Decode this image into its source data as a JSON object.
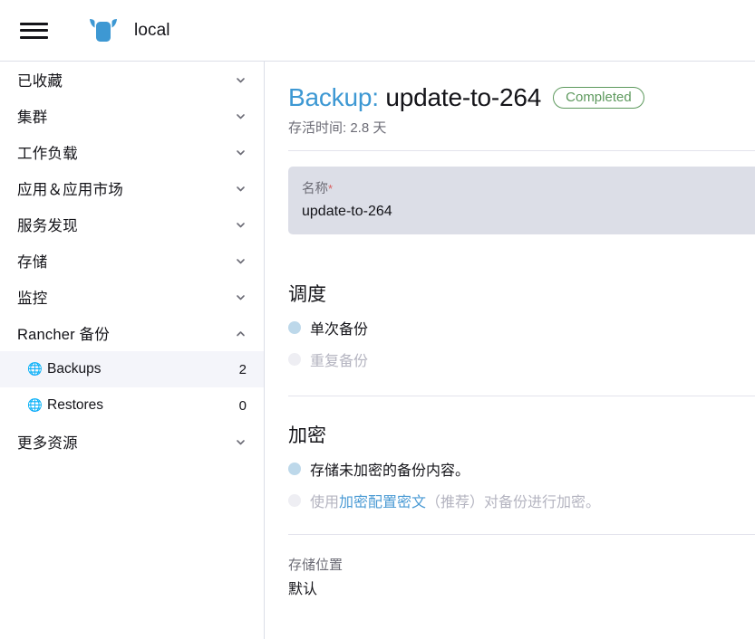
{
  "header": {
    "menu_icon": "hamburger-icon",
    "logo_icon": "rancher-cow-logo",
    "cluster_name": "local"
  },
  "sidebar": {
    "groups": [
      {
        "label": "已收藏",
        "expanded": false
      },
      {
        "label": "集群",
        "expanded": false
      },
      {
        "label": "工作负载",
        "expanded": false
      },
      {
        "label": "应用＆应用市场",
        "expanded": false
      },
      {
        "label": "服务发现",
        "expanded": false
      },
      {
        "label": "存储",
        "expanded": false
      },
      {
        "label": "监控",
        "expanded": false
      },
      {
        "label": "Rancher 备份",
        "expanded": true
      }
    ],
    "children": [
      {
        "label": "Backups",
        "count": "2",
        "icon": "globe-icon",
        "active": true
      },
      {
        "label": "Restores",
        "count": "0",
        "icon": "globe-icon",
        "active": false
      }
    ],
    "more_resources": {
      "label": "更多资源",
      "expanded": false
    }
  },
  "main": {
    "title_kind": "Backup:",
    "title_name": "update-to-264",
    "status_badge": "Completed",
    "status_color": "#5d995d",
    "subtitle": "存活时间: 2.8 天",
    "name_field": {
      "label": "名称",
      "required_mark": "*",
      "value": "update-to-264"
    },
    "schedule": {
      "heading": "调度",
      "options": [
        {
          "label": "单次备份",
          "selected": true
        },
        {
          "label": "重复备份",
          "selected": false
        }
      ]
    },
    "encryption": {
      "heading": "加密",
      "options": [
        {
          "label": "存储未加密的备份内容。",
          "selected": true
        },
        {
          "prefix": "使用",
          "link": "加密配置密文",
          "suffix": "（推荐）对备份进行加密。",
          "selected": false
        }
      ]
    },
    "storage": {
      "label": "存储位置",
      "value": "默认"
    }
  }
}
